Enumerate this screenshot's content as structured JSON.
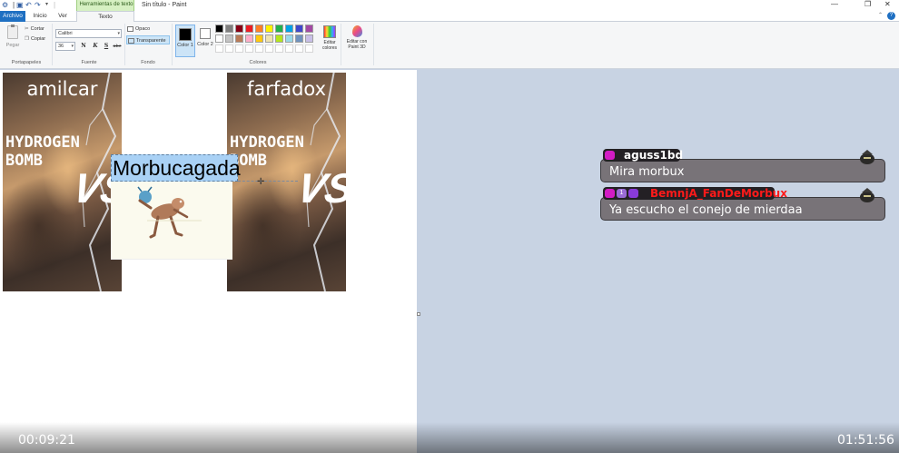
{
  "window": {
    "title": "Sin título - Paint",
    "context_group": "Herramientas de texto"
  },
  "tabs": [
    {
      "label": "Archivo"
    },
    {
      "label": "Inicio"
    },
    {
      "label": "Ver"
    },
    {
      "label": "Texto"
    }
  ],
  "ribbon": {
    "clipboard": {
      "paste": "Pegar",
      "cut": "Cortar",
      "copy": "Copiar",
      "label": "Portapapeles"
    },
    "font": {
      "family": "Calibri",
      "size": "36",
      "bold": "N",
      "italic": "K",
      "underline": "S",
      "strike": "abc",
      "label": "Fuente"
    },
    "background": {
      "opaque": "Opaco",
      "transparent": "Transparente",
      "label": "Fondo"
    },
    "colors": {
      "color1": "Color 1",
      "color2": "Color 2",
      "edit": "Editar colores",
      "label": "Colores",
      "color1_value": "#000000",
      "color2_value": "#ffffff",
      "palette_row1": [
        "#000000",
        "#7f7f7f",
        "#880015",
        "#ed1c24",
        "#ff7f27",
        "#fff200",
        "#22b14c",
        "#00a2e8",
        "#3f48cc",
        "#a349a4"
      ],
      "palette_row2": [
        "#ffffff",
        "#c3c3c3",
        "#b97a57",
        "#ffaec9",
        "#ffc90e",
        "#efe4b0",
        "#b5e61d",
        "#99d9ea",
        "#7092be",
        "#c8bfe7"
      ]
    },
    "paint3d": "Editar con Paint 3D"
  },
  "canvas": {
    "left_card": {
      "name": "amilcar",
      "bomb_line1": "HYDROGEN",
      "bomb_line2": "BOMB",
      "vs": "VS"
    },
    "right_card": {
      "name": "farfadox",
      "bomb_line1": "HYDROGEN",
      "bomb_line2": "BOMB",
      "vs": "VS"
    },
    "text_box": "Morbucagada"
  },
  "chat": [
    {
      "user": "aguss1bd",
      "message": "Mira morbux",
      "user_color": "#ffffff"
    },
    {
      "user": "BemnjA_FanDeMorbux",
      "message": "Ya escucho el conejo de mierdaa",
      "user_color": "#ff1a1a"
    }
  ],
  "video": {
    "elapsed": "00:09:21",
    "total": "01:51:56"
  }
}
